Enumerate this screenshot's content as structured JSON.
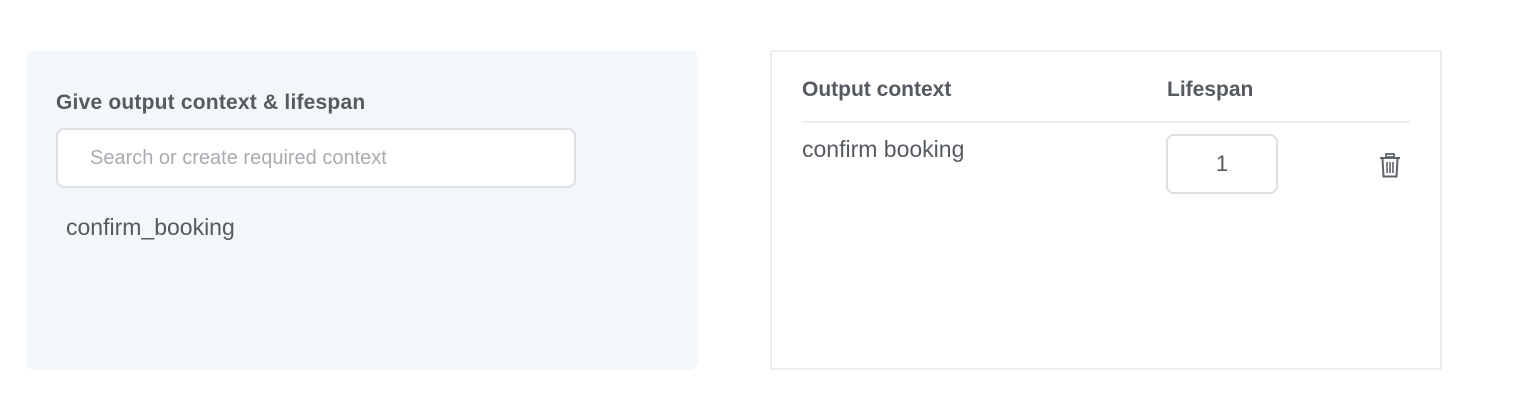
{
  "left_panel": {
    "title": "Give output context & lifespan",
    "search": {
      "placeholder": "Search or create required context",
      "value": ""
    },
    "items": [
      "confirm_booking"
    ]
  },
  "right_panel": {
    "columns": [
      "Output context",
      "Lifespan"
    ],
    "rows": [
      {
        "context": "confirm booking",
        "lifespan": "1",
        "action_icon": "trash-icon"
      }
    ]
  },
  "colors": {
    "left_panel_bg": "#f4f7fa",
    "text": "#555a61",
    "border": "#dcdfe3",
    "placeholder": "#a8abb0"
  }
}
